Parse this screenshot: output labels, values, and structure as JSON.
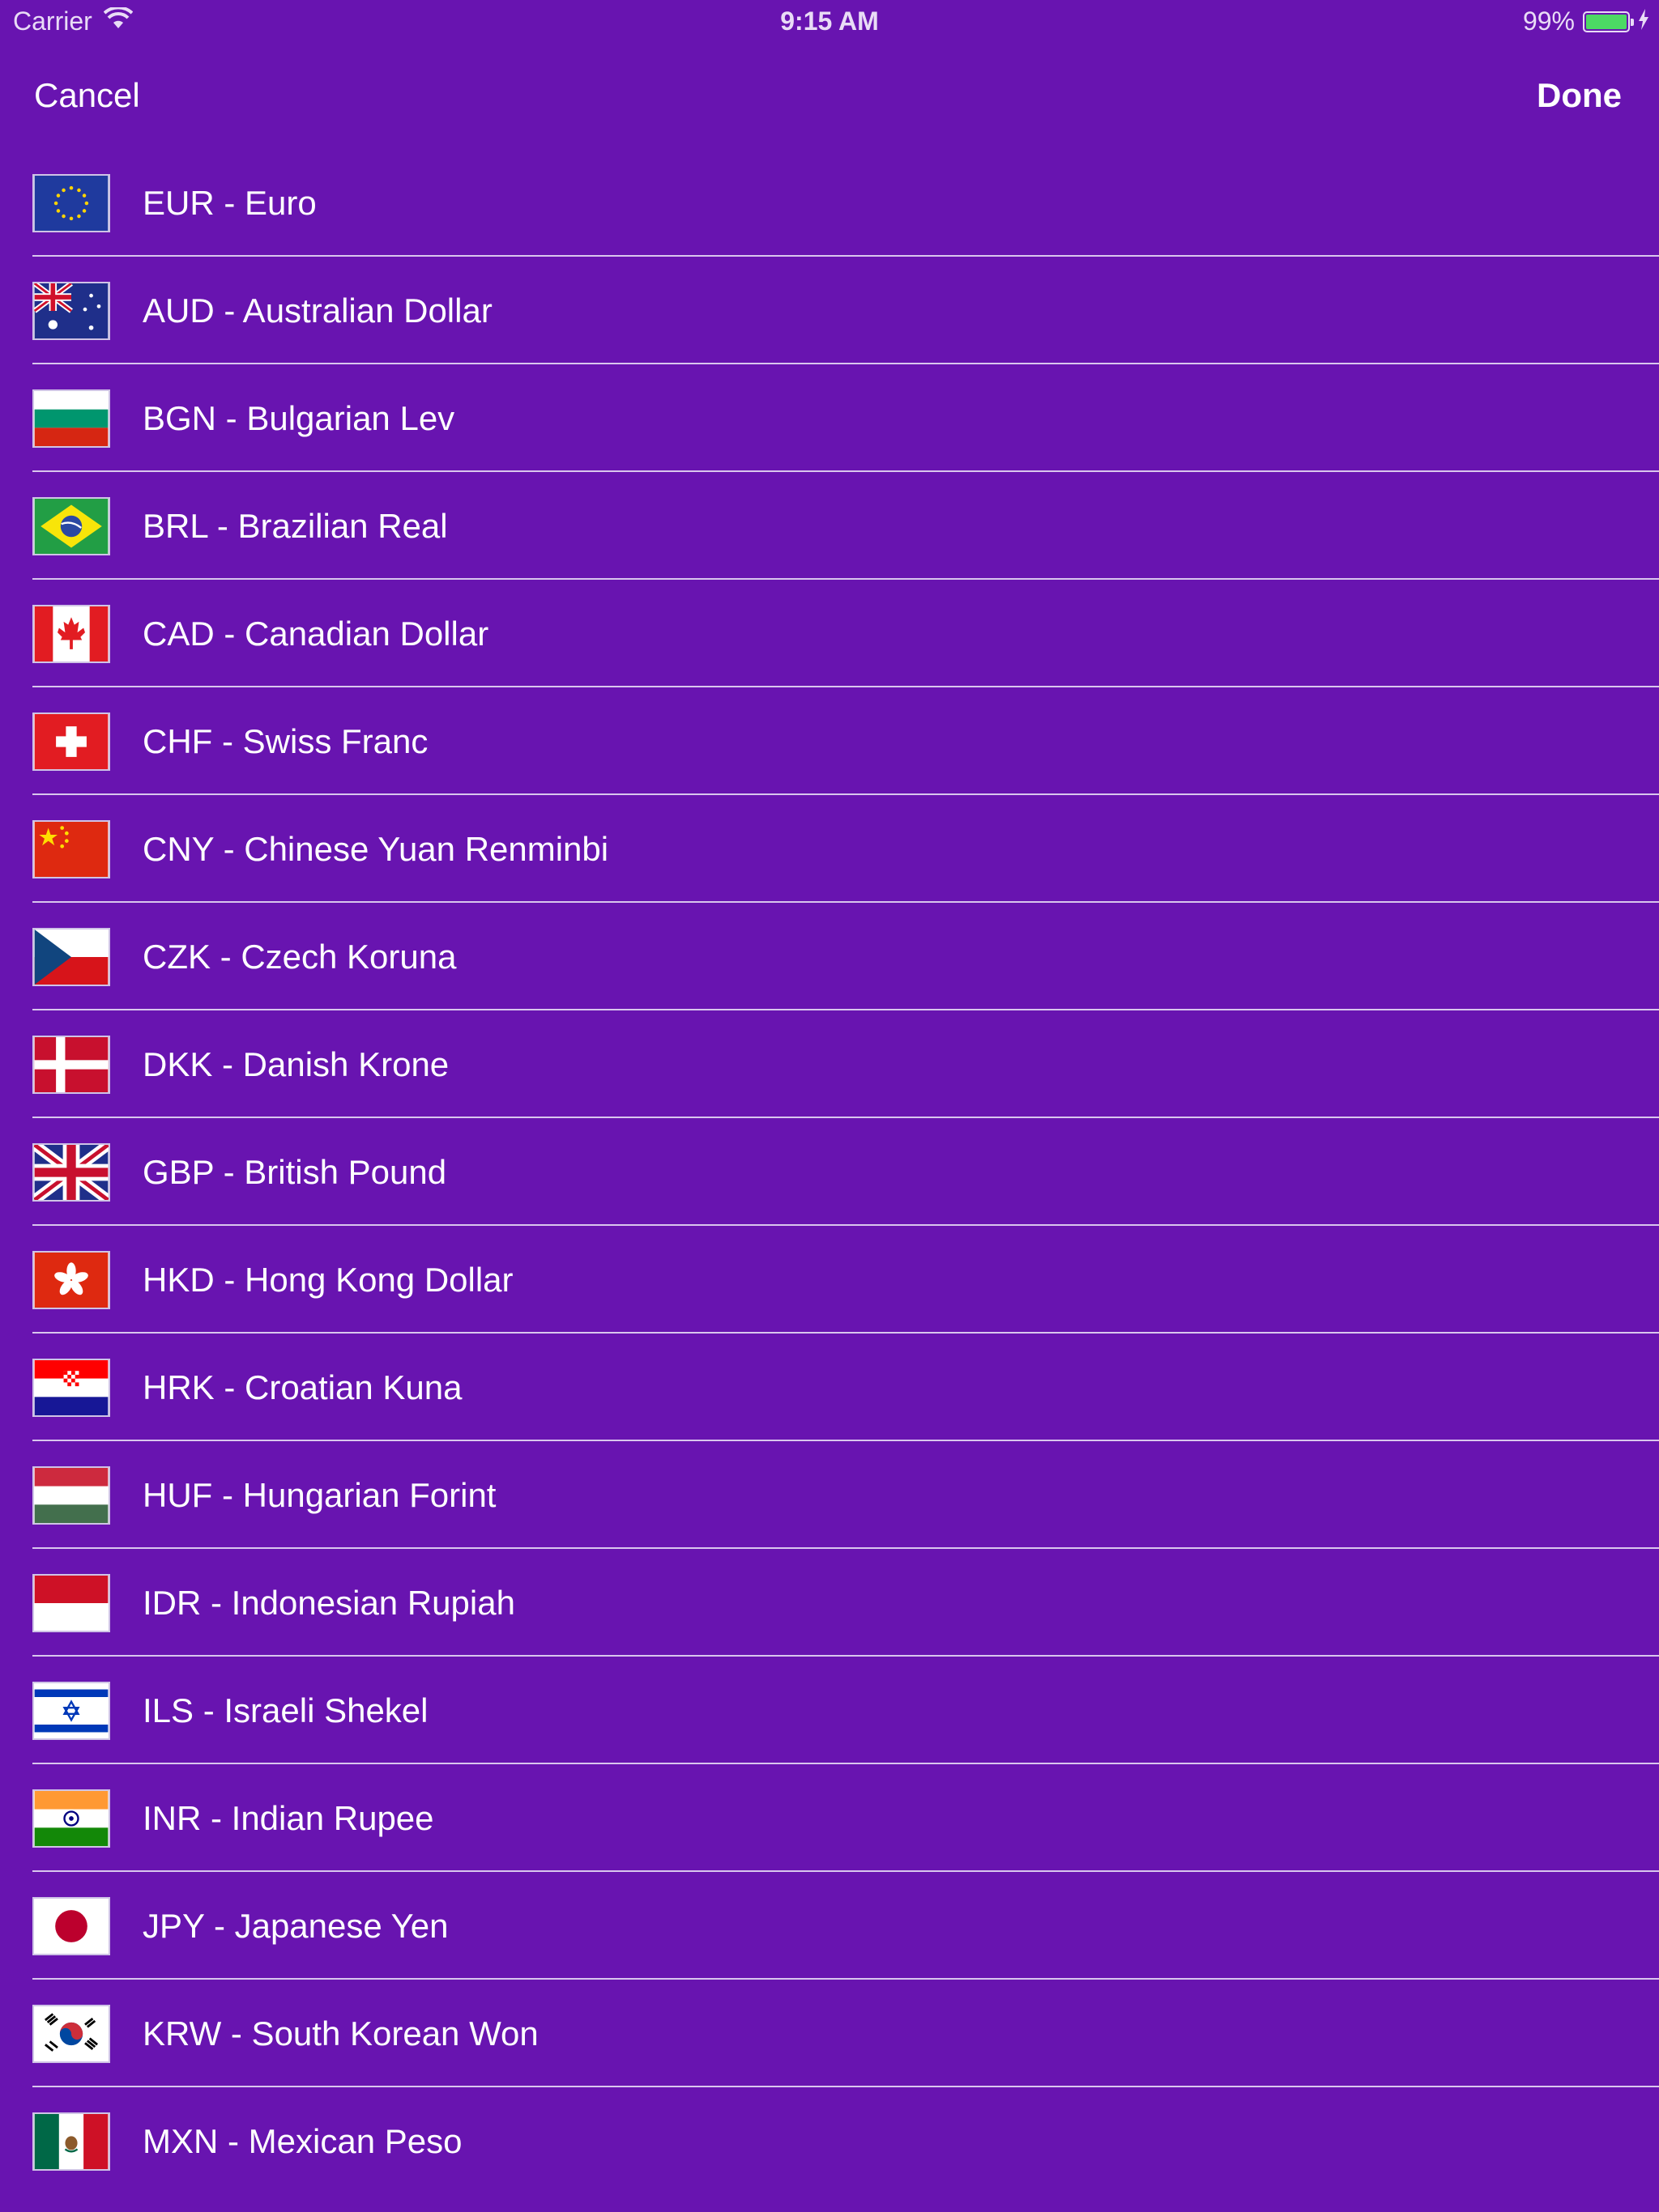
{
  "status_bar": {
    "carrier": "Carrier",
    "time": "9:15 AM",
    "battery_percent": "99%",
    "battery_level": 0.99
  },
  "nav": {
    "cancel_label": "Cancel",
    "done_label": "Done"
  },
  "colors": {
    "background": "#6814b0",
    "separator": "#d9c6ee",
    "text": "#ffffff"
  },
  "currencies": [
    {
      "label": "EUR - Euro",
      "flag": "eu-flag-icon"
    },
    {
      "label": "AUD - Australian Dollar",
      "flag": "australia-flag-icon"
    },
    {
      "label": "BGN - Bulgarian Lev",
      "flag": "bulgaria-flag-icon"
    },
    {
      "label": "BRL - Brazilian Real",
      "flag": "brazil-flag-icon"
    },
    {
      "label": "CAD - Canadian Dollar",
      "flag": "canada-flag-icon"
    },
    {
      "label": "CHF - Swiss Franc",
      "flag": "switzerland-flag-icon"
    },
    {
      "label": "CNY - Chinese Yuan Renminbi",
      "flag": "china-flag-icon"
    },
    {
      "label": "CZK - Czech Koruna",
      "flag": "czech-flag-icon"
    },
    {
      "label": "DKK - Danish Krone",
      "flag": "denmark-flag-icon"
    },
    {
      "label": "GBP - British Pound",
      "flag": "uk-flag-icon"
    },
    {
      "label": "HKD - Hong Kong Dollar",
      "flag": "hong-kong-flag-icon"
    },
    {
      "label": "HRK - Croatian Kuna",
      "flag": "croatia-flag-icon"
    },
    {
      "label": "HUF - Hungarian Forint",
      "flag": "hungary-flag-icon"
    },
    {
      "label": "IDR - Indonesian Rupiah",
      "flag": "indonesia-flag-icon"
    },
    {
      "label": "ILS - Israeli Shekel",
      "flag": "israel-flag-icon"
    },
    {
      "label": "INR - Indian Rupee",
      "flag": "india-flag-icon"
    },
    {
      "label": "JPY - Japanese Yen",
      "flag": "japan-flag-icon"
    },
    {
      "label": "KRW - South Korean Won",
      "flag": "south-korea-flag-icon"
    },
    {
      "label": "MXN - Mexican Peso",
      "flag": "mexico-flag-icon"
    }
  ]
}
